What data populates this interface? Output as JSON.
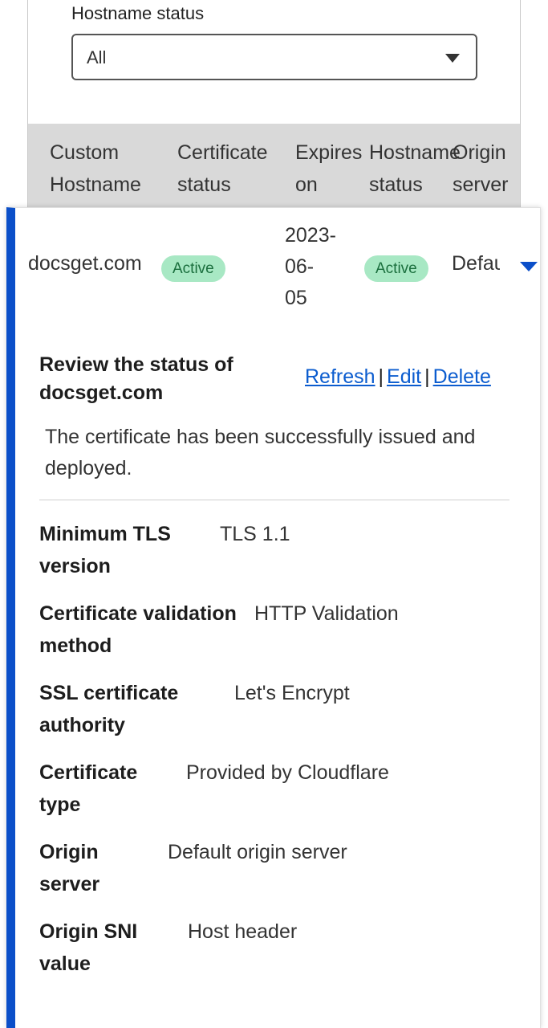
{
  "filter": {
    "label": "Hostname status",
    "selected": "All"
  },
  "table": {
    "headers": [
      "Custom\nHostname",
      "Certificate\nstatus",
      "Expires\non",
      "Hostname\nstatus",
      "Origin\nserver"
    ],
    "row": {
      "hostname": "docsget.com",
      "certificate_status": "Active",
      "expires_on": "2023-\n06-\n05",
      "hostname_status": "Active",
      "origin_server": "Default origin server"
    }
  },
  "details": {
    "title": "Review the status of docsget.com",
    "actions": {
      "refresh": "Refresh",
      "edit": "Edit",
      "delete": "Delete",
      "separator": "|"
    },
    "message": "The certificate has been successfully issued and deployed.",
    "items": [
      {
        "label": "Minimum TLS version",
        "value": "TLS 1.1"
      },
      {
        "label": "Certificate validation method",
        "value": "HTTP Validation"
      },
      {
        "label": "SSL certificate authority",
        "value": "Let's Encrypt"
      },
      {
        "label": "Certificate type",
        "value": "Provided by Cloudflare"
      },
      {
        "label": "Origin server",
        "value": "Default origin server"
      },
      {
        "label": "Origin SNI value",
        "value": "Host header"
      }
    ]
  },
  "colors": {
    "accent": "#0b4fc9",
    "link": "#0b5ccf",
    "badge_bg": "#a8e8c4",
    "badge_text": "#1b6f3e",
    "header_bg": "#d9d9d9"
  }
}
